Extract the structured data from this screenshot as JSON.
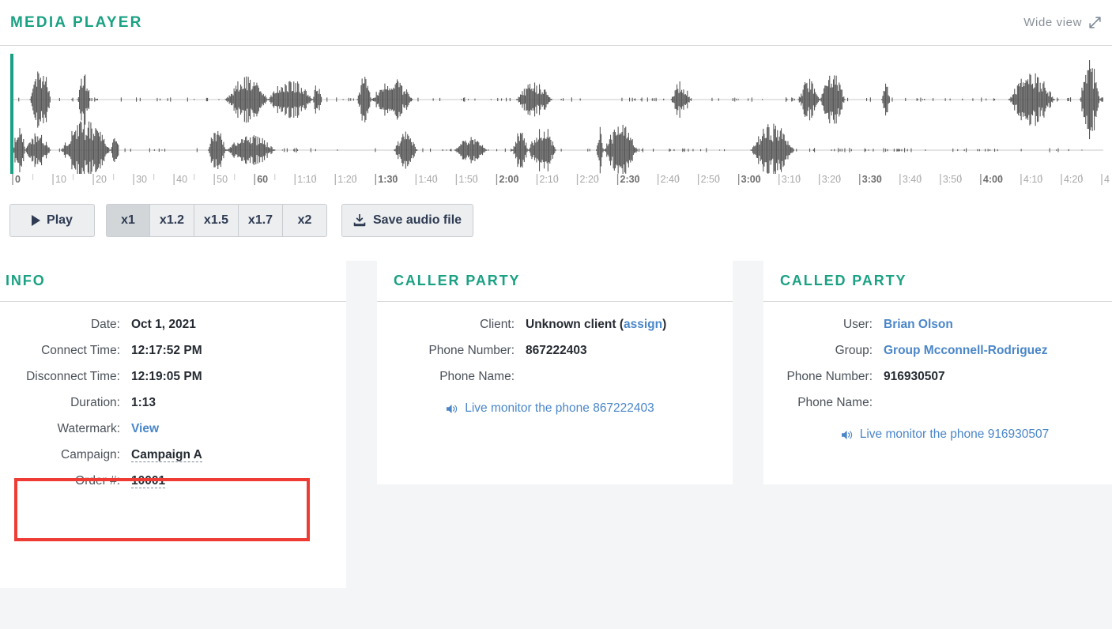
{
  "player": {
    "title": "MEDIA PLAYER",
    "wide_view_label": "Wide view",
    "expand_icon": "expand-arrows-icon",
    "play_label": "Play",
    "play_icon": "play-triangle-icon",
    "save_label": "Save audio file",
    "save_icon": "download-icon",
    "speeds": [
      {
        "label": "x1",
        "active": true
      },
      {
        "label": "x1.2",
        "active": false
      },
      {
        "label": "x1.5",
        "active": false
      },
      {
        "label": "x1.7",
        "active": false
      },
      {
        "label": "x2",
        "active": false
      }
    ],
    "playhead_color": "#1aa183",
    "waveform_color": "#595959",
    "timeline_labels": [
      "0",
      "10",
      "20",
      "30",
      "40",
      "50",
      "60",
      "1:10",
      "1:20",
      "1:30",
      "1:40",
      "1:50",
      "2:00",
      "2:10",
      "2:20",
      "2:30",
      "2:40",
      "2:50",
      "3:00",
      "3:10",
      "3:20",
      "3:30",
      "3:40",
      "3:50",
      "4:00",
      "4:10",
      "4:20",
      "4"
    ],
    "playhead_position": "0"
  },
  "info": {
    "title": "INFO",
    "rows": [
      {
        "label": "Date:",
        "value": "Oct 1, 2021",
        "type": "text"
      },
      {
        "label": "Connect Time:",
        "value": "12:17:52 PM",
        "type": "text"
      },
      {
        "label": "Disconnect Time:",
        "value": "12:19:05 PM",
        "type": "text"
      },
      {
        "label": "Duration:",
        "value": "1:13",
        "type": "text"
      },
      {
        "label": "Watermark:",
        "value": "View",
        "type": "link"
      },
      {
        "label": "Campaign:",
        "value": "Campaign A",
        "type": "editable"
      },
      {
        "label": "Order #:",
        "value": "10001",
        "type": "editable"
      }
    ]
  },
  "caller_party": {
    "title": "CALLER PARTY",
    "client_label": "Client:",
    "client_value": "Unknown client (",
    "client_assign": "assign",
    "client_value_end": ")",
    "phone_number_label": "Phone Number:",
    "phone_number_value": "867222403",
    "phone_name_label": "Phone Name:",
    "phone_name_value": "",
    "monitor_label": "Live monitor the phone 867222403",
    "monitor_icon": "speaker-icon"
  },
  "called_party": {
    "title": "CALLED PARTY",
    "user_label": "User:",
    "user_value": "Brian Olson",
    "group_label": "Group:",
    "group_value": "Group Mcconnell-Rodriguez",
    "phone_number_label": "Phone Number:",
    "phone_number_value": "916930507",
    "phone_name_label": "Phone Name:",
    "phone_name_value": "",
    "monitor_label": "Live monitor the phone 916930507",
    "monitor_icon": "speaker-icon"
  },
  "theme": {
    "accent": "#1aa183",
    "link": "#4a86c8",
    "highlight": "#ee3b33",
    "page_bg": "#f4f5f7"
  }
}
